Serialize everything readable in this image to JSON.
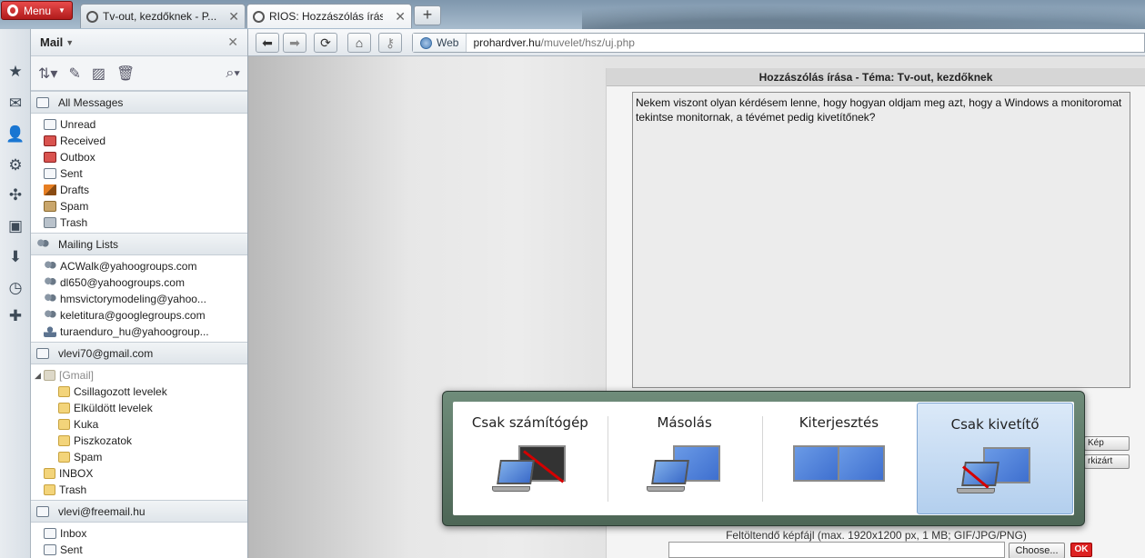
{
  "browser": {
    "menu_label": "Menu",
    "tabs": [
      {
        "title": "Tv-out, kezdőknek - P..."
      },
      {
        "title": "RIOS: Hozzászólás írása..."
      }
    ],
    "address": {
      "web_badge": "Web",
      "url_host": "prohardver.hu",
      "url_path": "/muvelet/hsz/uj.php"
    }
  },
  "mail": {
    "title": "Mail",
    "all_messages": "All Messages",
    "folders": [
      "Unread",
      "Received",
      "Outbox",
      "Sent",
      "Drafts",
      "Spam",
      "Trash"
    ],
    "mailing_lists_title": "Mailing Lists",
    "mailing_lists": [
      "ACWalk@yahoogroups.com",
      "dl650@yahoogroups.com",
      "hmsvictorymodeling@yahoo...",
      "keletitura@googlegroups.com",
      "turaenduro_hu@yahoogroup..."
    ],
    "account1": {
      "name": "vlevi70@gmail.com",
      "gmail_folder": "[Gmail]",
      "subfolders": [
        "Csillagozott levelek",
        "Elküldött levelek",
        "Kuka",
        "Piszkozatok",
        "Spam"
      ],
      "inbox": "INBOX",
      "trash": "Trash"
    },
    "account2": {
      "name": "vlevi@freemail.hu",
      "folders": [
        "Inbox",
        "Sent"
      ]
    }
  },
  "page": {
    "form_title": "Hozzászólás írása - Téma: Tv-out, kezdőknek",
    "message_text": "Nekem viszont olyan kérdésem lenne, hogy hogyan oldjam meg azt, hogy a Windows a monitoromat tekintse monitornak, a tévémet pedig kivetítőnek?",
    "side_button_1": "Kép",
    "side_button_2": "rkizárt",
    "upload_label": "Feltöltendő képfájl (max. 1920x1200 px, 1 MB; GIF/JPG/PNG)",
    "choose_label": "Choose...",
    "ok_label": "OK"
  },
  "display_switch": {
    "options": [
      {
        "label": "Csak számítógép",
        "selected": false
      },
      {
        "label": "Másolás",
        "selected": false
      },
      {
        "label": "Kiterjesztés",
        "selected": false
      },
      {
        "label": "Csak kivetítő",
        "selected": true
      }
    ],
    "accent_color": "#3e6fcf",
    "selection_color": "#b3cfee"
  },
  "icons": [
    "opera-icon",
    "back-icon",
    "forward-icon",
    "reload-icon",
    "home-icon",
    "key-icon",
    "globe-icon",
    "bookmarks-icon",
    "mail-icon",
    "contacts-icon",
    "settings-icon",
    "unite-icon",
    "notes-icon",
    "downloads-icon",
    "history-icon",
    "add-panel-icon",
    "binoculars-icon",
    "compose-icon",
    "trash-icon"
  ]
}
